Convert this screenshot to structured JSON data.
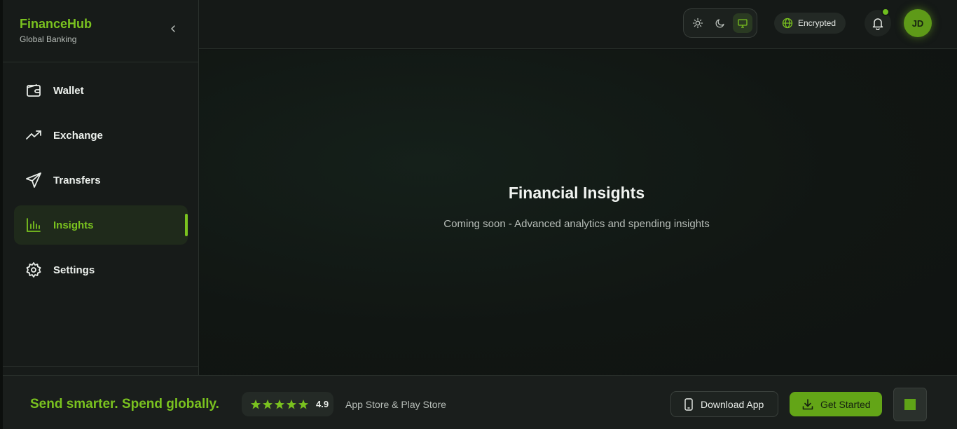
{
  "brand": {
    "name": "FinanceHub",
    "subtitle": "Global Banking"
  },
  "sidebar": {
    "items": [
      {
        "label": "Wallet",
        "icon": "wallet-icon",
        "active": false
      },
      {
        "label": "Exchange",
        "icon": "trending-up-icon",
        "active": false
      },
      {
        "label": "Transfers",
        "icon": "send-icon",
        "active": false
      },
      {
        "label": "Insights",
        "icon": "bar-chart-icon",
        "active": true
      },
      {
        "label": "Settings",
        "icon": "gear-icon",
        "active": false
      }
    ]
  },
  "header": {
    "theme_options": [
      "light",
      "dark",
      "system"
    ],
    "theme_selected": "system",
    "security_badge": "Encrypted",
    "avatar_initials": "JD"
  },
  "main": {
    "title": "Financial Insights",
    "subtitle": "Coming soon - Advanced analytics and spending insights"
  },
  "footer": {
    "tagline": "Send smarter. Spend globally.",
    "rating": "4.9",
    "stars": 5,
    "stores": "App Store & Play Store",
    "download_label": "Download App",
    "get_started_label": "Get Started"
  },
  "colors": {
    "accent": "#7ac21f",
    "background": "#111513",
    "sidebar": "#171b19"
  }
}
